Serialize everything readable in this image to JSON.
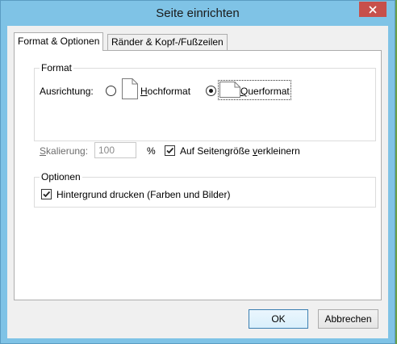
{
  "window": {
    "title": "Seite einrichten"
  },
  "tabs": [
    {
      "label": "Format & Optionen",
      "active": true
    },
    {
      "label": "Ränder & Kopf-/Fußzeilen",
      "active": false
    }
  ],
  "format_group": {
    "legend": "Format",
    "orientation": {
      "label": "Ausrichtung:",
      "portrait": {
        "prefix": "",
        "accel": "H",
        "rest": "ochformat",
        "selected": false
      },
      "landscape": {
        "prefix": "",
        "accel": "Q",
        "rest": "uerformat",
        "selected": true
      }
    },
    "scaling": {
      "accel": "S",
      "rest": "kalierung:",
      "value": "100",
      "unit": "%"
    },
    "shrink": {
      "checked": true,
      "prefix": "Auf Seitengröße ",
      "accel": "v",
      "rest": "erkleinern"
    }
  },
  "options_group": {
    "legend": "Optionen",
    "background": {
      "checked": true,
      "prefix": "Hinter",
      "accel": "g",
      "rest": "rund drucken (Farben und Bilder)"
    }
  },
  "buttons": {
    "ok": "OK",
    "cancel": "Abbrechen"
  },
  "colors": {
    "titlebar": "#7fc3e6",
    "close": "#c7504b",
    "panel": "#ffffff",
    "dialog": "#f0f0f0"
  }
}
